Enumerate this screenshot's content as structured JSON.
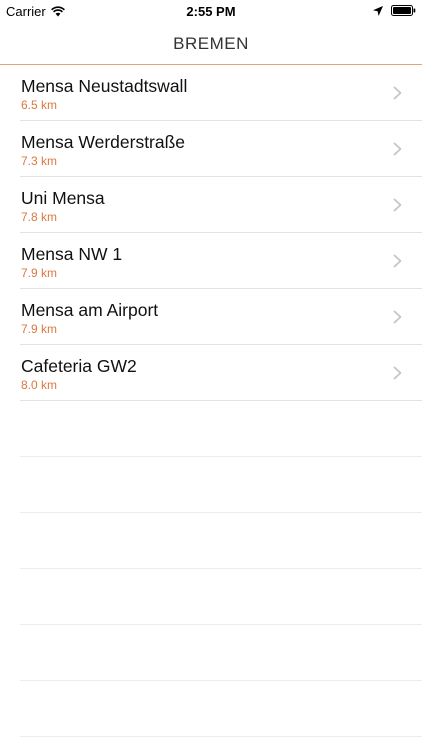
{
  "status_bar": {
    "carrier": "Carrier",
    "time": "2:55 PM",
    "icons": [
      "wifi-icon",
      "location-arrow-icon",
      "battery-icon"
    ]
  },
  "nav": {
    "title": "BREMEN"
  },
  "accent_color": "#d9783f",
  "items": [
    {
      "name": "Mensa Neustadtswall",
      "distance": "6.5 km"
    },
    {
      "name": "Mensa Werderstraße",
      "distance": "7.3 km"
    },
    {
      "name": "Uni Mensa",
      "distance": "7.8 km"
    },
    {
      "name": "Mensa NW 1",
      "distance": "7.9 km"
    },
    {
      "name": "Mensa am Airport",
      "distance": "7.9 km"
    },
    {
      "name": "Cafeteria GW2",
      "distance": "8.0 km"
    }
  ]
}
